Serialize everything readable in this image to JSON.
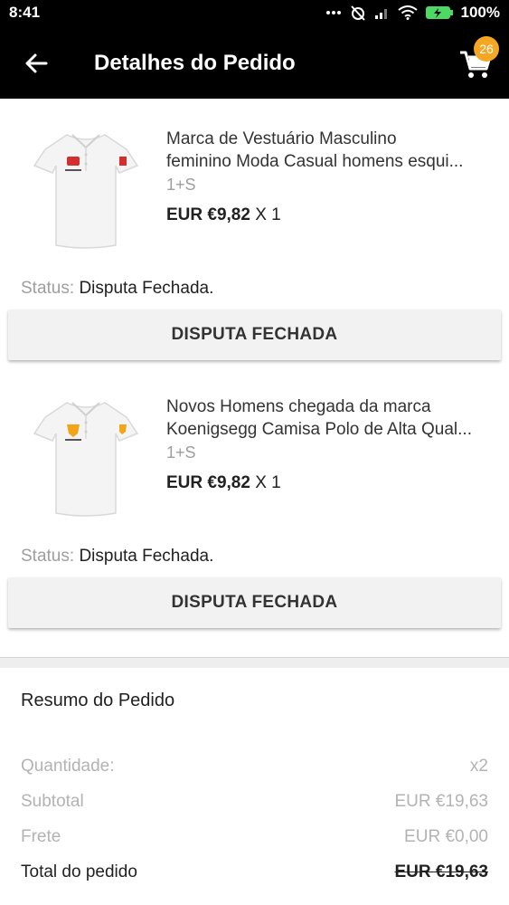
{
  "status_bar": {
    "time": "8:41",
    "battery": "100%"
  },
  "header": {
    "title": "Detalhes do Pedido",
    "cart_count": "26"
  },
  "items": [
    {
      "name_line1": "Marca de Vestuário Masculino",
      "name_line2": "feminino Moda Casual homens esqui...",
      "variant": "1+S",
      "price": "EUR €9,82",
      "qty": "X 1",
      "status_label": "Status:",
      "status_value": "Disputa Fechada.",
      "button_label": "DISPUTA FECHADA",
      "logo_color": "#d32f2f"
    },
    {
      "name_line1": "Novos Homens chegada da marca",
      "name_line2": "Koenigsegg Camisa Polo de Alta Qual...",
      "variant": "1+S",
      "price": "EUR €9,82",
      "qty": "X 1",
      "status_label": "Status:",
      "status_value": "Disputa Fechada.",
      "button_label": "DISPUTA FECHADA",
      "logo_color": "#f2a516"
    }
  ],
  "summary": {
    "title": "Resumo do Pedido",
    "rows": [
      {
        "label": "Quantidade:",
        "value": "x2"
      },
      {
        "label": "Subtotal",
        "value": "EUR €19,63"
      },
      {
        "label": "Frete",
        "value": "EUR €0,00"
      },
      {
        "label": "Total do pedido",
        "value": "EUR €19,63"
      }
    ]
  },
  "colors": {
    "badge": "#f5a623",
    "header_bg": "#000000",
    "battery": "#4cd964"
  }
}
